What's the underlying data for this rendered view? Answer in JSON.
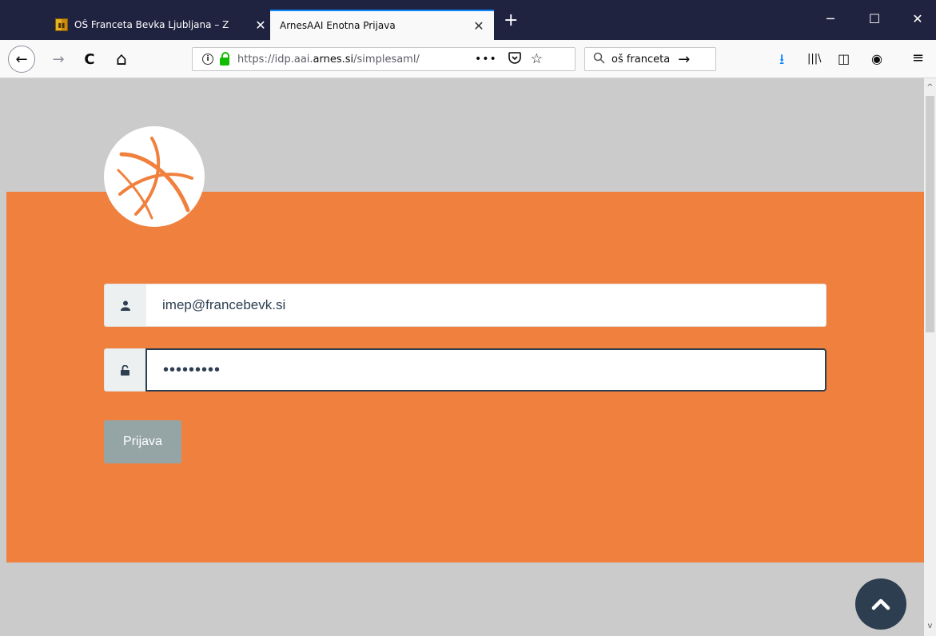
{
  "browser": {
    "tabs": [
      {
        "label": "OŠ Franceta Bevka Ljubljana – Z",
        "close": "✕",
        "active": false
      },
      {
        "label": "ArnesAAI Enotna Prijava",
        "close": "✕",
        "active": true
      }
    ],
    "new_tab": "+",
    "window_controls": {
      "minimize": "─",
      "maximize": "☐",
      "close": "✕"
    },
    "nav": {
      "back": "←",
      "forward": "→",
      "reload": "C",
      "home": "⌂"
    },
    "url_prefix": "https://idp.aai.",
    "url_host": "arnes.si",
    "url_path": "/simplesaml/",
    "page_actions": "•••",
    "search_query": "oš franceta",
    "toolbar_icons": {
      "download": "⭳",
      "library": "|||\\",
      "sidebar": "◫",
      "account": "◉",
      "menu": "≡"
    }
  },
  "login": {
    "username": "imep@francebevk.si",
    "password_mask": "•••••••••",
    "submit_label": "Prijava"
  },
  "colors": {
    "accent": "#f0803e",
    "dark": "#2c3e50",
    "button": "#95a5a6"
  }
}
